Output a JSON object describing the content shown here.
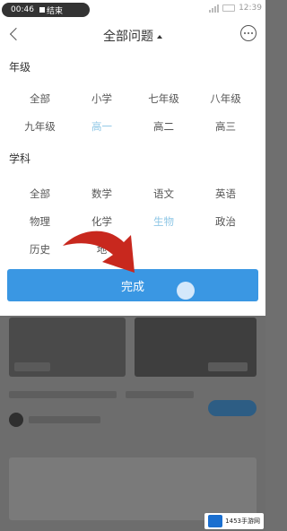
{
  "status_bar": {
    "time": "00:46",
    "stop_label": "结束",
    "right_text": "12:39"
  },
  "header": {
    "title": "全部问题"
  },
  "filters": {
    "grade_label": "年级",
    "grades": [
      "全部",
      "小学",
      "七年级",
      "八年级",
      "九年级",
      "高一",
      "高二",
      "高三"
    ],
    "grade_selected": "高一",
    "subject_label": "学科",
    "subjects": [
      "全部",
      "数学",
      "语文",
      "英语",
      "物理",
      "化学",
      "生物",
      "政治",
      "历史",
      "地"
    ],
    "subject_selected": "生物"
  },
  "done_button": {
    "label": "完成"
  },
  "watermark": {
    "text": "1453手游网"
  },
  "colors": {
    "accent": "#3a97e3",
    "selected_text": "#8fc7e6",
    "arrow": "#c8281e"
  }
}
